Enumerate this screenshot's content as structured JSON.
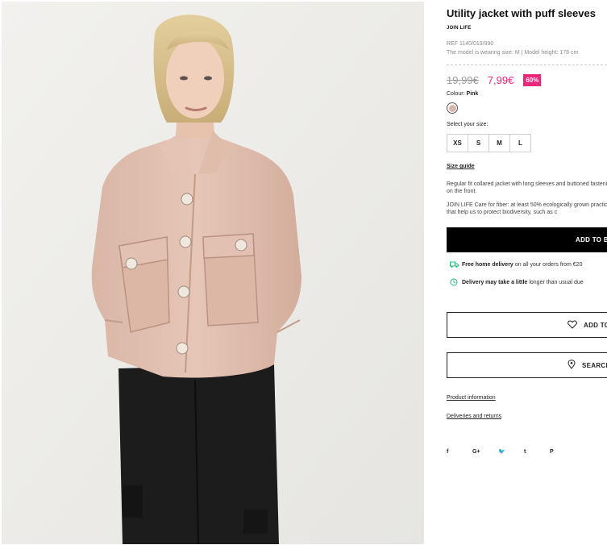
{
  "product": {
    "title": "Utility jacket with puff sleeves",
    "brand_line": "JOIN LIFE",
    "ref": "REF 1140/019/990",
    "model_info": "The model is wearing size: M | Model height: 178 cm"
  },
  "pricing": {
    "old_price": "19,99€",
    "new_price": "7,99€",
    "discount": "60%"
  },
  "colour": {
    "label": "Colour:",
    "value": "Pink",
    "swatch_color": "#d8b6ac"
  },
  "sizes": {
    "label": "Select your size:",
    "options": [
      "XS",
      "S",
      "M",
      "L"
    ]
  },
  "size_guide": "Size guide",
  "description": {
    "text1": "Regular fit collared jacket with long sleeves and buttoned fastening on the front.",
    "text2": "JOIN LIFE Care for fiber: at least 50% ecologically grown practices that help us to protect biodiversity, such as c"
  },
  "add_to_bag": "ADD TO B",
  "delivery": {
    "free_bold": "Free home delivery",
    "free_rest": "on all your orders from €20",
    "delay_bold": "Delivery may take a little",
    "delay_rest": "longer than usual due"
  },
  "buttons": {
    "wishlist": "ADD TO",
    "store": "SEARCH"
  },
  "links": {
    "product_info": "Product information",
    "deliveries": "Deliveries and returns"
  },
  "social": [
    "f",
    "G+",
    "🐦",
    "t",
    "P"
  ],
  "colors": {
    "accent": "#e8287a",
    "button_bg": "#000000",
    "delivery_icon": "#2bb673"
  }
}
